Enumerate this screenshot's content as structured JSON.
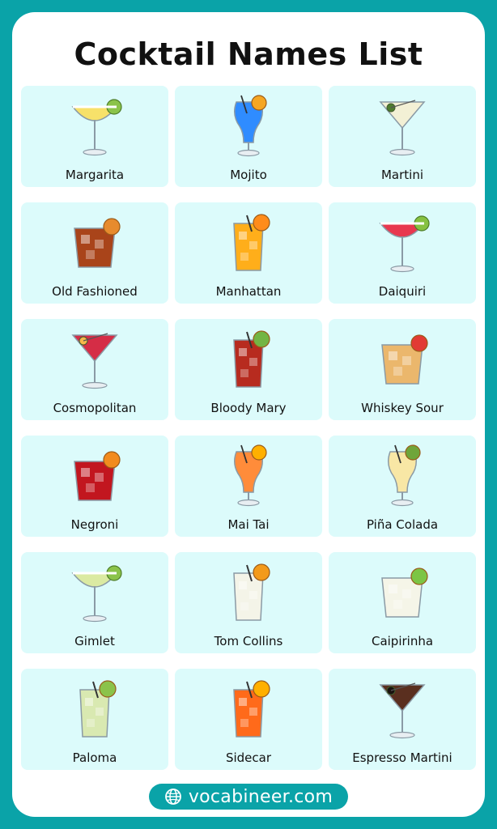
{
  "header": {
    "title": "Cocktail Names List"
  },
  "cocktails": [
    {
      "name": "Margarita",
      "icon": "margarita-glass-icon",
      "glass": "coupe",
      "liquid": "#f7e16a",
      "garnish": "#8bc34a",
      "rim": "#ffffff"
    },
    {
      "name": "Mojito",
      "icon": "blue-hurricane-glass-icon",
      "glass": "hurricane",
      "liquid": "#2f8cff",
      "garnish": "#f5a623"
    },
    {
      "name": "Martini",
      "icon": "martini-glass-icon",
      "glass": "martini",
      "liquid": "#f3f0d5",
      "garnish": "#4e7b2f"
    },
    {
      "name": "Old Fashioned",
      "icon": "rocks-glass-icon",
      "glass": "rocks",
      "liquid": "#a9441a",
      "garnish": "#e78b2d"
    },
    {
      "name": "Manhattan",
      "icon": "highball-glass-icon",
      "glass": "highball",
      "liquid": "#ffae1a",
      "garnish": "#ff8c1a"
    },
    {
      "name": "Daiquiri",
      "icon": "daiquiri-glass-icon",
      "glass": "coupe",
      "liquid": "#e8384f",
      "garnish": "#86c141"
    },
    {
      "name": "Cosmopolitan",
      "icon": "cosmopolitan-glass-icon",
      "glass": "martini",
      "liquid": "#d52d46",
      "garnish": "#f7b64b"
    },
    {
      "name": "Bloody Mary",
      "icon": "bloody-mary-glass-icon",
      "glass": "highball",
      "liquid": "#b72b1f",
      "garnish": "#72b544"
    },
    {
      "name": "Whiskey Sour",
      "icon": "whiskey-sour-glass-icon",
      "glass": "rocks",
      "liquid": "#ebb76c",
      "garnish": "#e23b34"
    },
    {
      "name": "Negroni",
      "icon": "negroni-glass-icon",
      "glass": "rocks",
      "liquid": "#c2161f",
      "garnish": "#f28b1e"
    },
    {
      "name": "Mai Tai",
      "icon": "mai-tai-glass-icon",
      "glass": "hurricane",
      "liquid": "#ff8c3a",
      "garnish": "#ffb000"
    },
    {
      "name": "Piña Colada",
      "icon": "pina-colada-glass-icon",
      "glass": "hurricane",
      "liquid": "#f8e7a5",
      "garnish": "#6fa53a"
    },
    {
      "name": "Gimlet",
      "icon": "gimlet-glass-icon",
      "glass": "coupe",
      "liquid": "#dbeaa2",
      "garnish": "#8bc34a"
    },
    {
      "name": "Tom Collins",
      "icon": "tom-collins-glass-icon",
      "glass": "highball",
      "liquid": "#f4f4e8",
      "garnish": "#f39a1a"
    },
    {
      "name": "Caipirinha",
      "icon": "caipirinha-glass-icon",
      "glass": "rocks",
      "liquid": "#f5f5e8",
      "garnish": "#7cc545"
    },
    {
      "name": "Paloma",
      "icon": "paloma-glass-icon",
      "glass": "highball",
      "liquid": "#d9e9b1",
      "garnish": "#8bc34a"
    },
    {
      "name": "Sidecar",
      "icon": "sidecar-glass-icon",
      "glass": "highball",
      "liquid": "#ff6a1a",
      "garnish": "#ffb000"
    },
    {
      "name": "Espresso Martini",
      "icon": "espresso-martini-glass-icon",
      "glass": "martini",
      "liquid": "#5a2f1f",
      "garnish": "#1a120f"
    }
  ],
  "footer": {
    "text": "vocabineer.com",
    "icon": "globe-icon"
  },
  "colors": {
    "border": "#0aa3a8",
    "tile": "#dcfbfb",
    "title": "#111111"
  }
}
